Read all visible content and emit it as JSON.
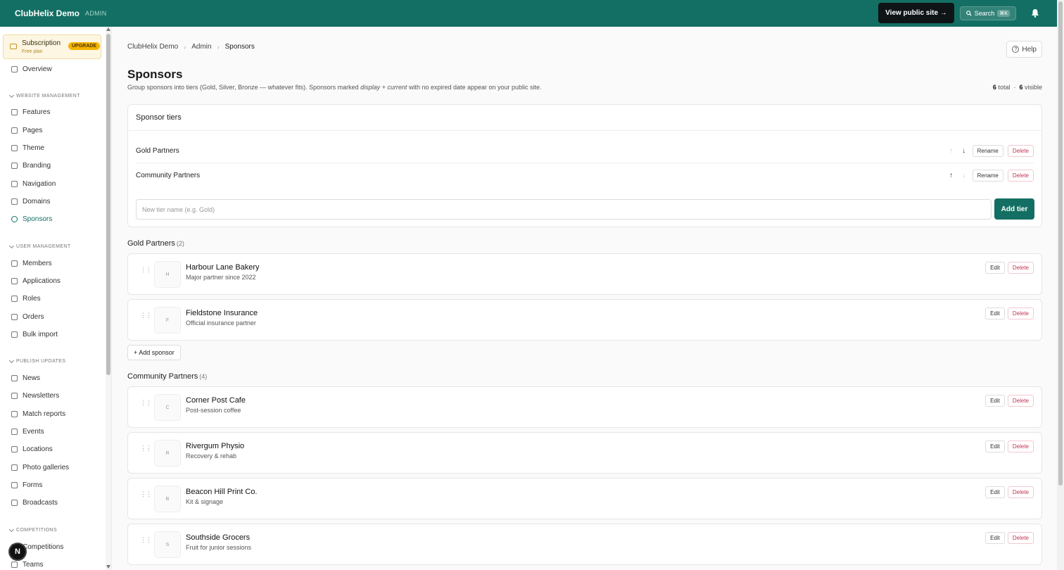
{
  "topbar": {
    "brand": "ClubHelix Demo",
    "tag": "ADMIN",
    "view_site": "View public site →",
    "search": "Search",
    "search_kbd": "⌘K"
  },
  "sidebar": {
    "subscription": {
      "title": "Subscription",
      "plan": "Free plan",
      "badge": "UPGRADE"
    },
    "overview": "Overview",
    "sections": {
      "website": "WEBSITE MANAGEMENT",
      "users": "USER MANAGEMENT",
      "publish": "PUBLISH UPDATES",
      "competitions": "COMPETITIONS"
    },
    "website_items": [
      "Features",
      "Pages",
      "Theme",
      "Branding",
      "Navigation",
      "Domains",
      "Sponsors"
    ],
    "user_items": [
      "Members",
      "Applications",
      "Roles",
      "Orders",
      "Bulk import"
    ],
    "publish_items": [
      "News",
      "Newsletters",
      "Match reports",
      "Events",
      "Locations",
      "Photo galleries",
      "Forms",
      "Broadcasts"
    ],
    "competition_items": [
      "Competitions",
      "Teams"
    ],
    "n_badge": "N"
  },
  "breadcrumb": [
    "ClubHelix Demo",
    "Admin",
    "Sponsors"
  ],
  "help": "Help",
  "page": {
    "title": "Sponsors",
    "subtitle_a": "Group sponsors into tiers (Gold, Silver, Bronze — whatever fits). Sponsors marked ",
    "subtitle_em": "display + current",
    "subtitle_b": " with no expired date appear on your public site.",
    "total_num": "6",
    "total_label": "total",
    "visible_num": "6",
    "visible_label": "visible"
  },
  "tiers": {
    "heading": "Sponsor tiers",
    "rows": [
      "Gold Partners",
      "Community Partners"
    ],
    "rename": "Rename",
    "delete": "Delete",
    "up": "↑",
    "down": "↓",
    "input_placeholder": "New tier name (e.g. Gold)",
    "add": "Add tier"
  },
  "groups": [
    {
      "name": "Gold Partners",
      "count": "(2)",
      "sponsors": [
        {
          "initial": "H",
          "name": "Harbour Lane Bakery",
          "desc": "Major partner since 2022"
        },
        {
          "initial": "F",
          "name": "Fieldstone Insurance",
          "desc": "Official insurance partner"
        }
      ]
    },
    {
      "name": "Community Partners",
      "count": "(4)",
      "sponsors": [
        {
          "initial": "C",
          "name": "Corner Post Cafe",
          "desc": "Post-session coffee"
        },
        {
          "initial": "R",
          "name": "Rivergum Physio",
          "desc": "Recovery & rehab"
        },
        {
          "initial": "B",
          "name": "Beacon Hill Print Co.",
          "desc": "Kit & signage"
        },
        {
          "initial": "S",
          "name": "Southside Grocers",
          "desc": "Fruit for junior sessions"
        }
      ]
    }
  ],
  "add_sponsor": "+ Add sponsor",
  "edit": "Edit",
  "delete": "Delete",
  "colors": {
    "accent": "#136f63",
    "danger": "#c03554",
    "upgrade": "#f4b400"
  }
}
